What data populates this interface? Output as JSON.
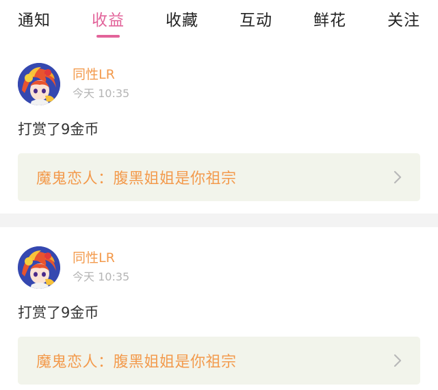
{
  "tabs": [
    {
      "label": "通知",
      "active": false
    },
    {
      "label": "收益",
      "active": true
    },
    {
      "label": "收藏",
      "active": false
    },
    {
      "label": "互动",
      "active": false
    },
    {
      "label": "鲜花",
      "active": false
    },
    {
      "label": "关注",
      "active": false
    }
  ],
  "colors": {
    "accent": "#e2639a",
    "username": "#f39a4c",
    "book_title": "#f39a4c",
    "link_background": "#f2f4eb",
    "divider": "#f3f3f3"
  },
  "notifications": [
    {
      "username": "同性LR",
      "time": "今天 10:35",
      "message": "打赏了9金币",
      "book": "魔鬼恋人：腹黑姐姐是你祖宗",
      "avatar_icon": "anime-avatar-icon",
      "link_icon": "chevron-right-icon"
    },
    {
      "username": "同性LR",
      "time": "今天 10:35",
      "message": "打赏了9金币",
      "book": "魔鬼恋人：腹黑姐姐是你祖宗",
      "avatar_icon": "anime-avatar-icon",
      "link_icon": "chevron-right-icon"
    }
  ]
}
